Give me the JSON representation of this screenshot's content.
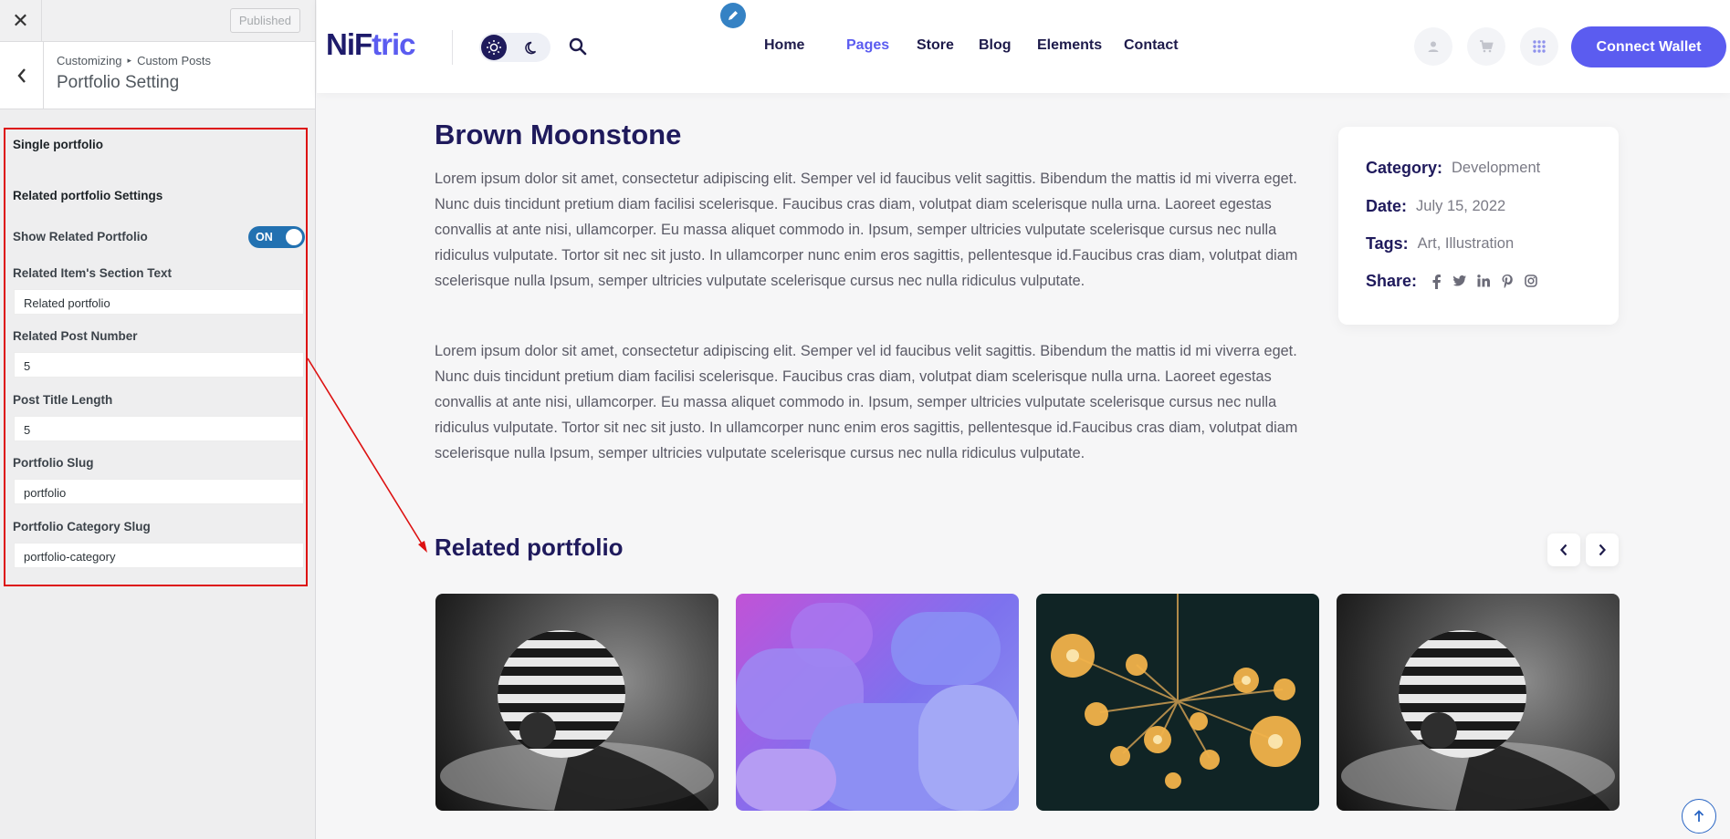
{
  "customizer": {
    "close_label": "✕",
    "published_label": "Published",
    "back_label": "‹",
    "breadcrumb": [
      "Customizing",
      "Custom Posts"
    ],
    "breadcrumb_sep": "▸",
    "panel_title": "Portfolio Setting",
    "sections": {
      "single": "Single portfolio",
      "related": "Related portfolio Settings"
    },
    "show_related": {
      "label": "Show Related Portfolio",
      "state": "ON"
    },
    "fields": [
      {
        "label": "Related Item's Section Text",
        "value": "Related portfolio"
      },
      {
        "label": "Related Post Number",
        "value": "5"
      },
      {
        "label": "Post Title Length",
        "value": "5"
      },
      {
        "label": "Portfolio Slug",
        "value": "portfolio"
      },
      {
        "label": "Portfolio Category Slug",
        "value": "portfolio-category"
      }
    ],
    "highlight_color": "#dd1111"
  },
  "header": {
    "logo_part1": "NiF",
    "logo_part2": "tric",
    "nav": [
      "Home",
      "Pages",
      "Store",
      "Blog",
      "Elements",
      "Contact"
    ],
    "active_nav": "Pages",
    "connect_label": "Connect Wallet",
    "icons": [
      "sun-icon",
      "moon-icon",
      "search-icon",
      "user-icon",
      "cart-icon",
      "grid-icon"
    ],
    "accent_color": "#5b5cf0",
    "brand_dark": "#1e1b6b"
  },
  "portfolio": {
    "title": "Brown Moonstone",
    "paragraphs": [
      "Lorem ipsum dolor sit amet, consectetur adipiscing elit. Semper vel id faucibus velit sagittis. Bibendum the mattis id mi viverra eget. Nunc duis tincidunt pretium diam facilisi scelerisque. Faucibus cras diam, volutpat diam scelerisque nulla urna. Laoreet egestas convallis at ante nisi, ullamcorper. Eu massa aliquet commodo in. Ipsum, semper ultricies vulputate scelerisque cursus nec nulla ridiculus vulputate. Tortor sit nec sit justo. In ullamcorper nunc enim eros sagittis, pellentesque id.Faucibus cras diam, volutpat diam scelerisque nulla Ipsum, semper ultricies vulputate scelerisque cursus nec nulla ridiculus vulputate.",
      "Lorem ipsum dolor sit amet, consectetur adipiscing elit. Semper vel id faucibus velit sagittis. Bibendum the mattis id mi viverra eget. Nunc duis tincidunt pretium diam facilisi scelerisque. Faucibus cras diam, volutpat diam scelerisque nulla urna. Laoreet egestas convallis at ante nisi, ullamcorper. Eu massa aliquet commodo in. Ipsum, semper ultricies vulputate scelerisque cursus nec nulla ridiculus vulputate. Tortor sit nec sit justo. In ullamcorper nunc enim eros sagittis, pellentesque id.Faucibus cras diam, volutpat diam scelerisque nulla Ipsum, semper ultricies vulputate scelerisque cursus nec nulla ridiculus vulputate."
    ],
    "info": {
      "category_label": "Category:",
      "category_value": "Development",
      "date_label": "Date:",
      "date_value": "July 15, 2022",
      "tags_label": "Tags:",
      "tags_value": "Art, Illustration",
      "share_label": "Share:",
      "share_icons": [
        "facebook-icon",
        "twitter-icon",
        "linkedin-icon",
        "pinterest-icon",
        "instagram-icon"
      ]
    },
    "related_title": "Related portfolio",
    "related_images": [
      "striped-sphere",
      "purple-3d-shapes",
      "glowing-bulbs-chandelier",
      "striped-sphere"
    ]
  }
}
